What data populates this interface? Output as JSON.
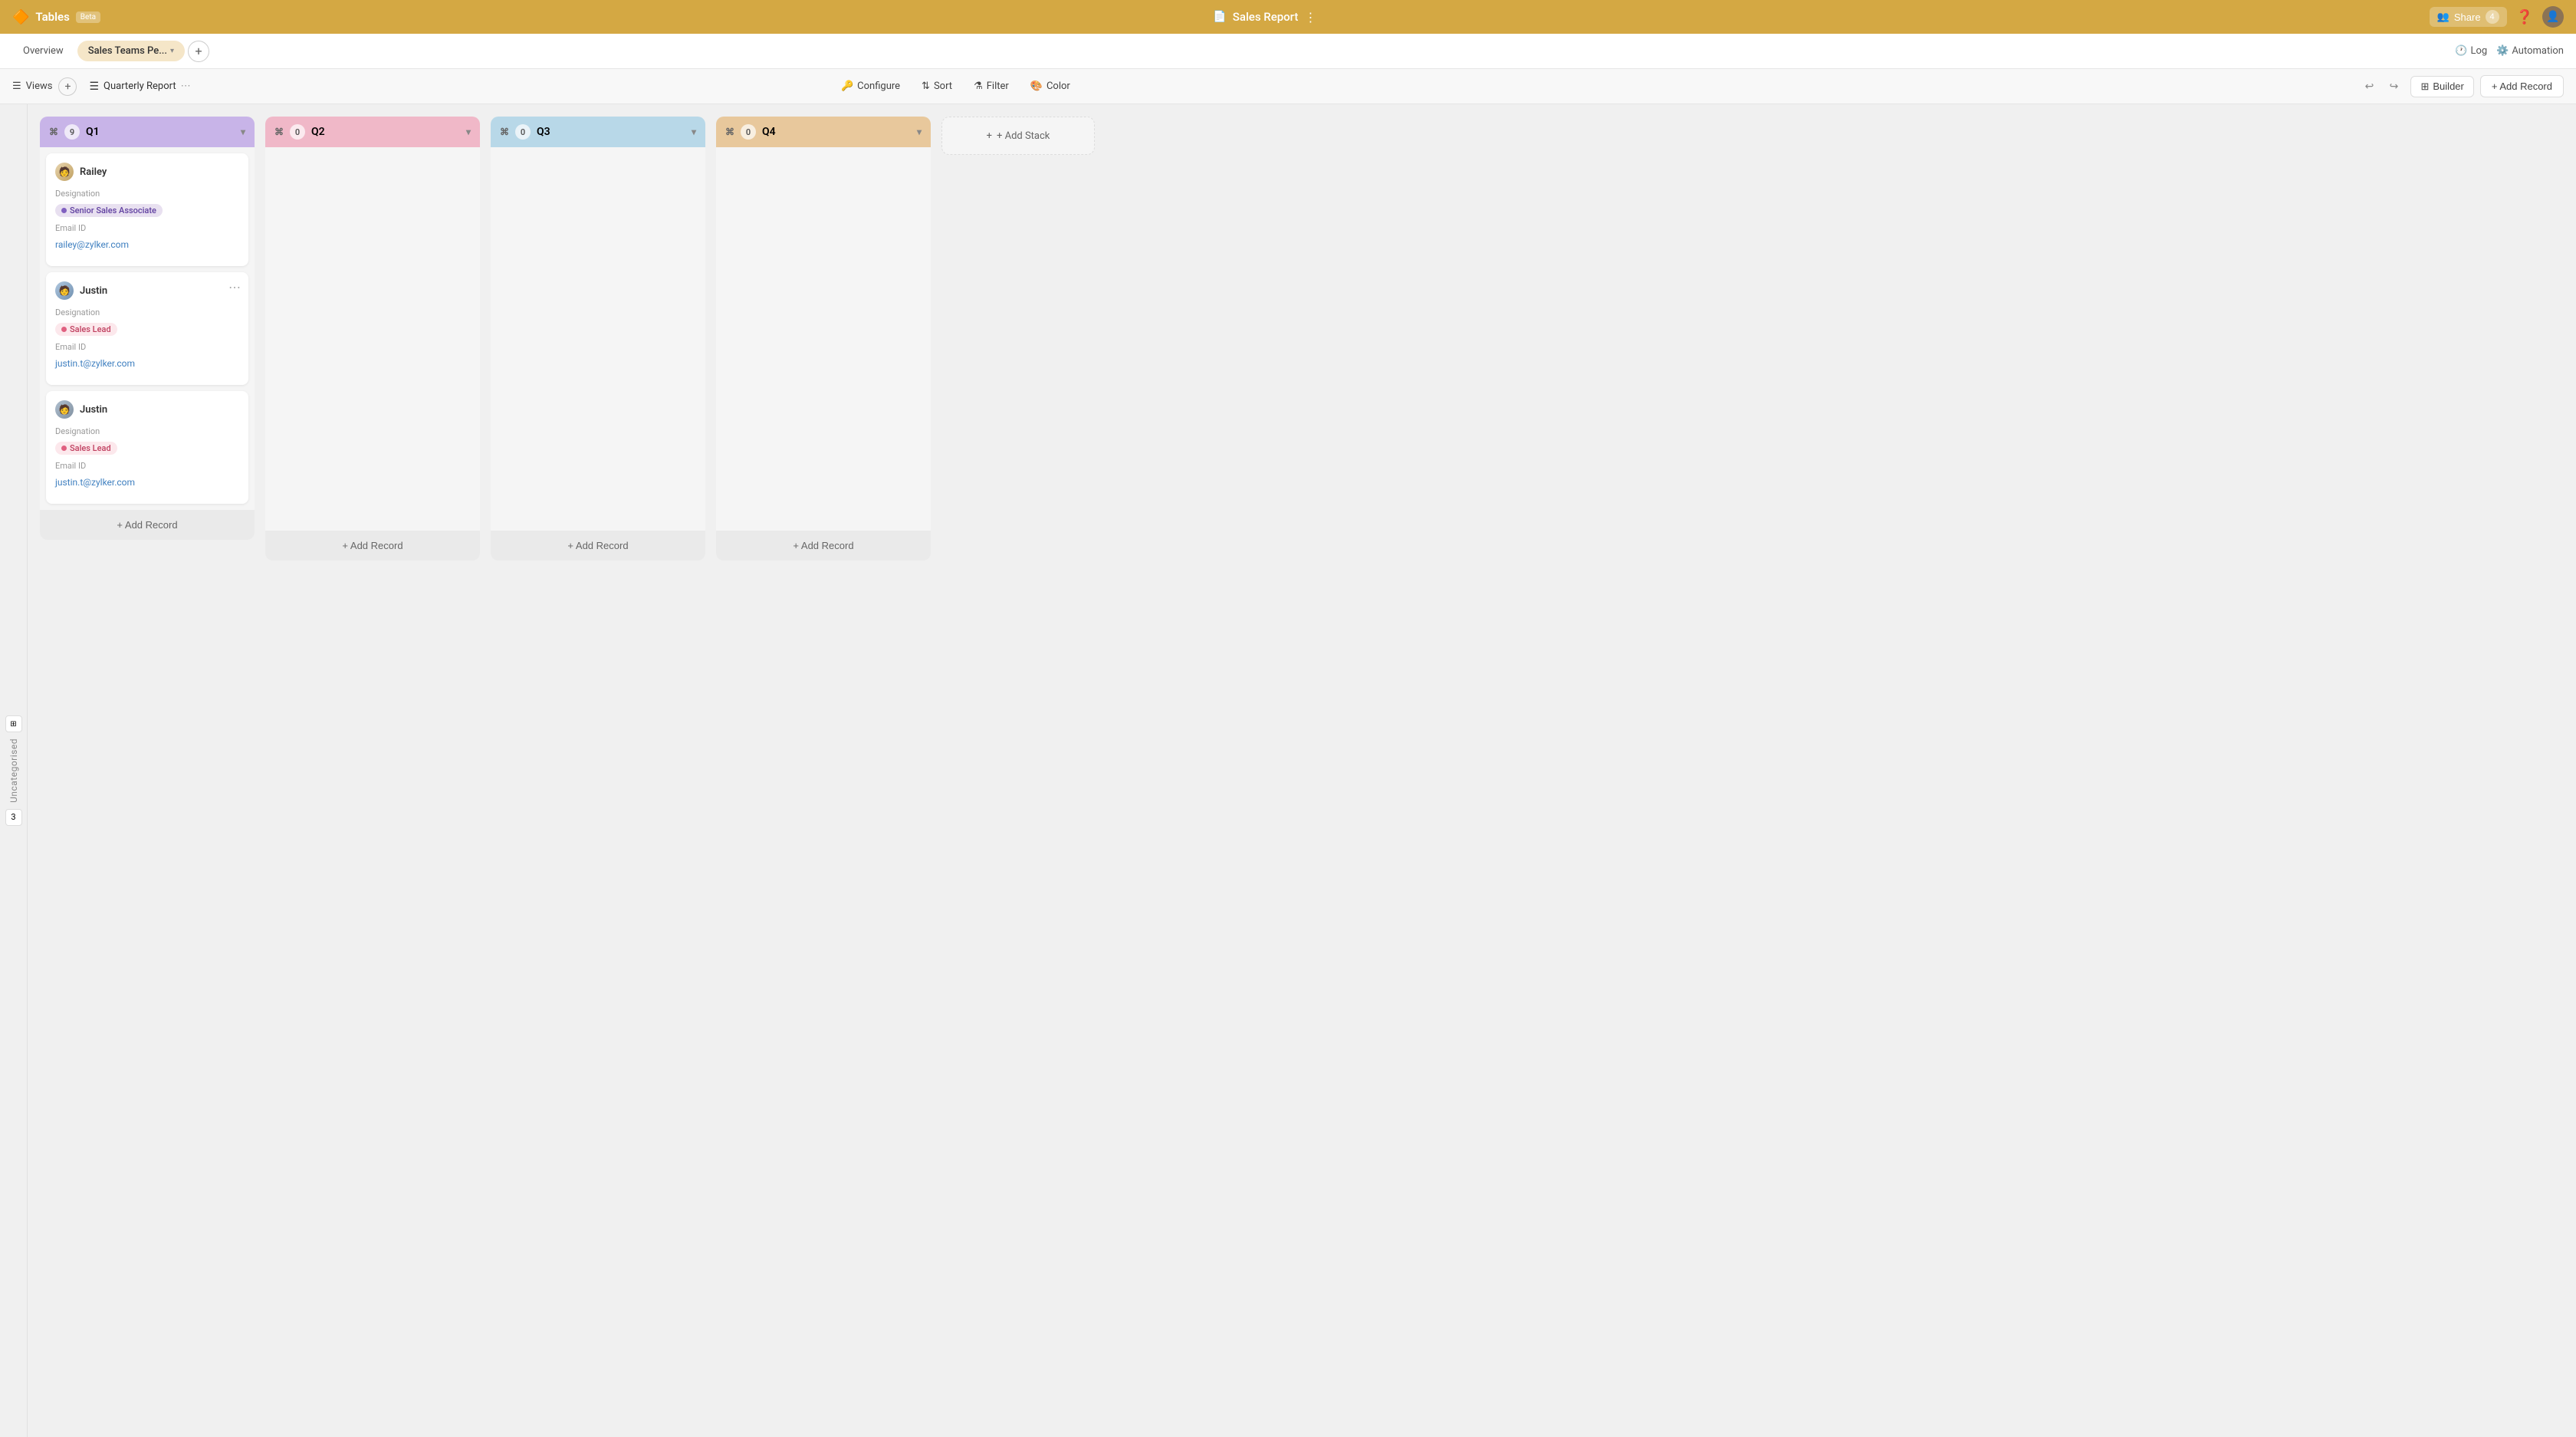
{
  "appBar": {
    "appName": "Tables",
    "beta": "Beta",
    "reportTitle": "Sales Report",
    "moreIcon": "⋮",
    "shareLabel": "Share",
    "shareCount": "4",
    "logLabel": "Log",
    "automationLabel": "Automation"
  },
  "tabBar": {
    "tabs": [
      {
        "id": "overview",
        "label": "Overview",
        "active": false
      },
      {
        "id": "sales-teams",
        "label": "Sales Teams Pe...",
        "active": true
      }
    ],
    "addTabIcon": "+",
    "logLabel": "Log",
    "automationLabel": "Automation"
  },
  "toolbar": {
    "viewsLabel": "Views",
    "addViewIcon": "+",
    "currentView": "Quarterly Report",
    "moreIcon": "⋯",
    "configureLabel": "Configure",
    "sortLabel": "Sort",
    "filterLabel": "Filter",
    "colorLabel": "Color",
    "builderLabel": "Builder",
    "addRecordLabel": "+ Add Record"
  },
  "sidebar": {
    "uncategorisedLabel": "Uncategorised",
    "collapseIcon": "⊞",
    "number": "3"
  },
  "kanban": {
    "stacks": [
      {
        "id": "q1",
        "label": "Q1",
        "count": 9,
        "colorClass": "q1-header",
        "cards": [
          {
            "id": "railey",
            "name": "Railey",
            "avatarClass": "railey",
            "designation": "Designation",
            "tagLabel": "Senior Sales Associate",
            "tagClass": "tag-senior",
            "emailLabel": "Email ID",
            "email": "railey@zylker.com",
            "hasMenu": false
          },
          {
            "id": "justin1",
            "name": "Justin",
            "avatarClass": "justin1",
            "designation": "Designation",
            "tagLabel": "Sales Lead",
            "tagClass": "tag-lead",
            "emailLabel": "Email ID",
            "email": "justin.t@zylker.com",
            "hasMenu": true
          },
          {
            "id": "justin2",
            "name": "Justin",
            "avatarClass": "justin2",
            "designation": "Designation",
            "tagLabel": "Sales Lead",
            "tagClass": "tag-lead",
            "emailLabel": "Email ID",
            "email": "justin.t@zylker.com",
            "hasMenu": false
          }
        ],
        "addRecordLabel": "+ Add Record"
      },
      {
        "id": "q2",
        "label": "Q2",
        "count": 0,
        "colorClass": "q2-header",
        "cards": [],
        "addRecordLabel": "+ Add Record"
      },
      {
        "id": "q3",
        "label": "Q3",
        "count": 0,
        "colorClass": "q3-header",
        "cards": [],
        "addRecordLabel": "+ Add Record"
      },
      {
        "id": "q4",
        "label": "Q4",
        "count": 0,
        "colorClass": "q4-header",
        "cards": [],
        "addRecordLabel": "+ Add Record"
      }
    ],
    "addStackLabel": "+ Add Stack"
  }
}
